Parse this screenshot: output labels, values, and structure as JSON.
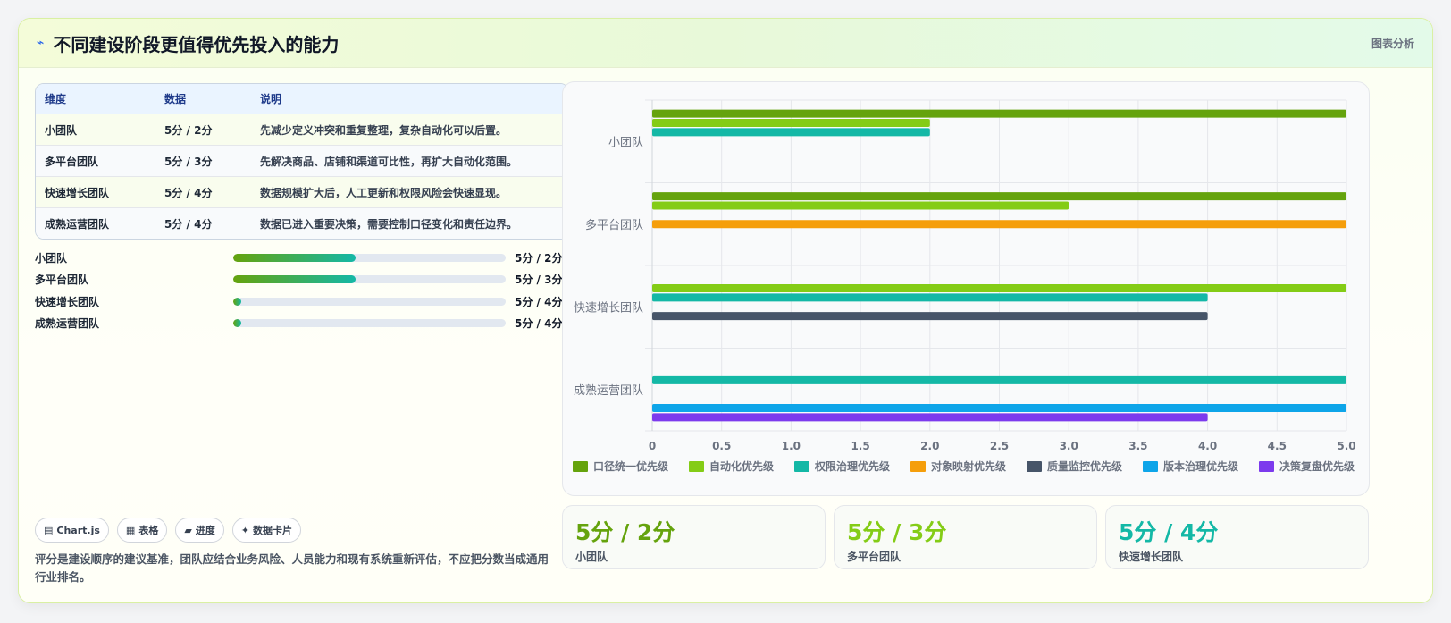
{
  "header": {
    "icon": "lightning-icon",
    "title": "不同建设阶段更值得优先投入的能力",
    "link": "图表分析"
  },
  "table": {
    "headers": [
      "维度",
      "数据",
      "说明"
    ],
    "rows": [
      {
        "name": "小团队",
        "value": "5分 / 2分",
        "desc": "先减少定义冲突和重复整理，复杂自动化可以后置。"
      },
      {
        "name": "多平台团队",
        "value": "5分 / 3分",
        "desc": "先解决商品、店铺和渠道可比性，再扩大自动化范围。"
      },
      {
        "name": "快速增长团队",
        "value": "5分 / 4分",
        "desc": "数据规模扩大后，人工更新和权限风险会快速显现。"
      },
      {
        "name": "成熟运营团队",
        "value": "5分 / 4分",
        "desc": "数据已进入重要决策，需要控制口径变化和责任边界。"
      }
    ]
  },
  "progress": [
    {
      "label": "小团队",
      "value": "5分 / 2分",
      "ratio": 0.45
    },
    {
      "label": "多平台团队",
      "value": "5分 / 3分",
      "ratio": 0.45
    },
    {
      "label": "快速增长团队",
      "value": "5分 / 4分",
      "ratio": 0.03
    },
    {
      "label": "成熟运营团队",
      "value": "5分 / 4分",
      "ratio": 0.03
    }
  ],
  "chips": [
    {
      "icon": "chart-icon",
      "glyph": "▤",
      "label": "Chart.js"
    },
    {
      "icon": "table-icon",
      "glyph": "▦",
      "label": "表格"
    },
    {
      "icon": "progress-icon",
      "glyph": "▰",
      "label": "进度"
    },
    {
      "icon": "sparkle-icon",
      "glyph": "✦",
      "label": "数据卡片"
    }
  ],
  "note": "评分是建设顺序的建议基准，团队应结合业务风险、人员能力和现有系统重新评估，不应把分数当成通用行业排名。",
  "stats": [
    {
      "value": "5分 / 2分",
      "label": "小团队",
      "color": "#65a30d"
    },
    {
      "value": "5分 / 3分",
      "label": "多平台团队",
      "color": "#84cc16"
    },
    {
      "value": "5分 / 4分",
      "label": "快速增长团队",
      "color": "#14b8a6"
    }
  ],
  "chart_data": {
    "type": "bar",
    "orientation": "horizontal",
    "categories": [
      "小团队",
      "多平台团队",
      "快速增长团队",
      "成熟运营团队"
    ],
    "xlim": [
      0,
      5
    ],
    "xticks": [
      "0",
      "0.5",
      "1.0",
      "1.5",
      "2.0",
      "2.5",
      "3.0",
      "3.5",
      "4.0",
      "4.5",
      "5.0"
    ],
    "grid": true,
    "legend_position": "bottom",
    "series": [
      {
        "name": "口径统一优先级",
        "color": "#65a30d",
        "values": [
          5,
          5,
          null,
          null
        ]
      },
      {
        "name": "自动化优先级",
        "color": "#84cc16",
        "values": [
          2,
          3,
          5,
          null
        ]
      },
      {
        "name": "权限治理优先级",
        "color": "#14b8a6",
        "values": [
          2,
          null,
          4,
          5
        ]
      },
      {
        "name": "对象映射优先级",
        "color": "#f59e0b",
        "values": [
          null,
          5,
          null,
          null
        ]
      },
      {
        "name": "质量监控优先级",
        "color": "#475569",
        "values": [
          null,
          null,
          4,
          null
        ]
      },
      {
        "name": "版本治理优先级",
        "color": "#0ea5e9",
        "values": [
          null,
          null,
          null,
          5
        ]
      },
      {
        "name": "决策复盘优先级",
        "color": "#7c3aed",
        "values": [
          null,
          null,
          null,
          4
        ]
      }
    ]
  }
}
